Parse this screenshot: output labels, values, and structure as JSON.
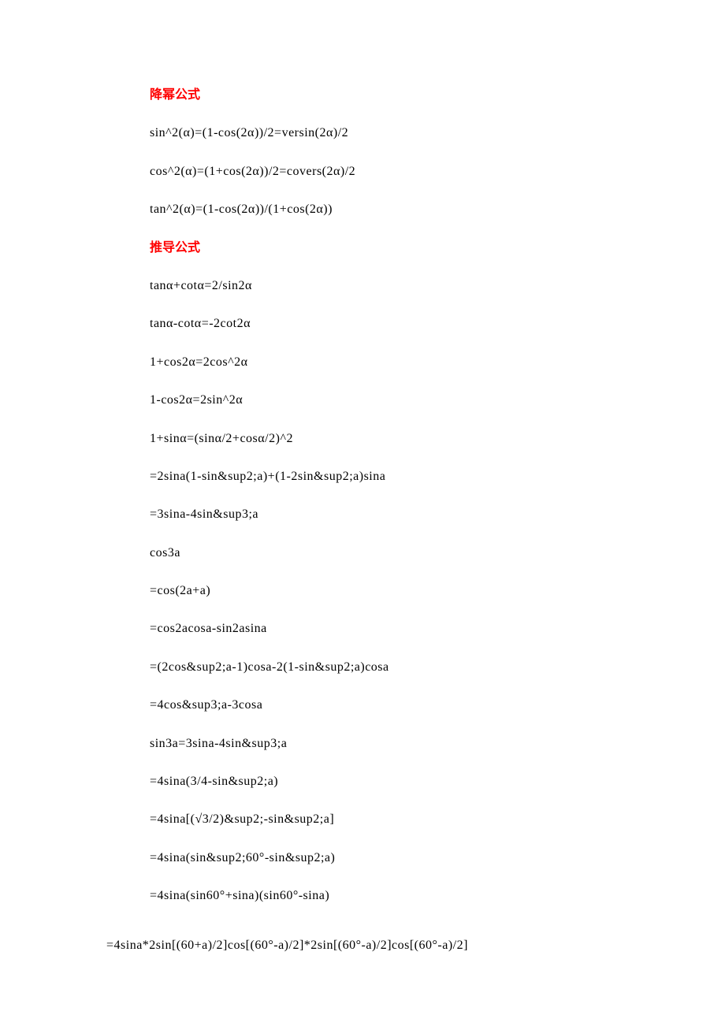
{
  "sections": [
    {
      "heading": "降幂公式",
      "lines": [
        "sin^2(α)=(1-cos(2α))/2=versin(2α)/2",
        "cos^2(α)=(1+cos(2α))/2=covers(2α)/2",
        "tan^2(α)=(1-cos(2α))/(1+cos(2α))"
      ]
    },
    {
      "heading": "推导公式",
      "lines": [
        "tanα+cotα=2/sin2α",
        "tanα-cotα=-2cot2α",
        "1+cos2α=2cos^2α",
        "1-cos2α=2sin^2α",
        "1+sinα=(sinα/2+cosα/2)^2",
        "=2sina(1-sin&sup2;a)+(1-2sin&sup2;a)sina",
        "=3sina-4sin&sup3;a",
        "cos3a",
        "=cos(2a+a)",
        "=cos2acosa-sin2asina",
        "=(2cos&sup2;a-1)cosa-2(1-sin&sup2;a)cosa",
        "=4cos&sup3;a-3cosa",
        "sin3a=3sina-4sin&sup3;a",
        "=4sina(3/4-sin&sup2;a)",
        "=4sina[(√3/2)&sup2;-sin&sup2;a]",
        "=4sina(sin&sup2;60°-sin&sup2;a)",
        "=4sina(sin60°+sina)(sin60°-sina)"
      ]
    }
  ],
  "footer_line": "=4sina*2sin[(60+a)/2]cos[(60°-a)/2]*2sin[(60°-a)/2]cos[(60°-a)/2]"
}
